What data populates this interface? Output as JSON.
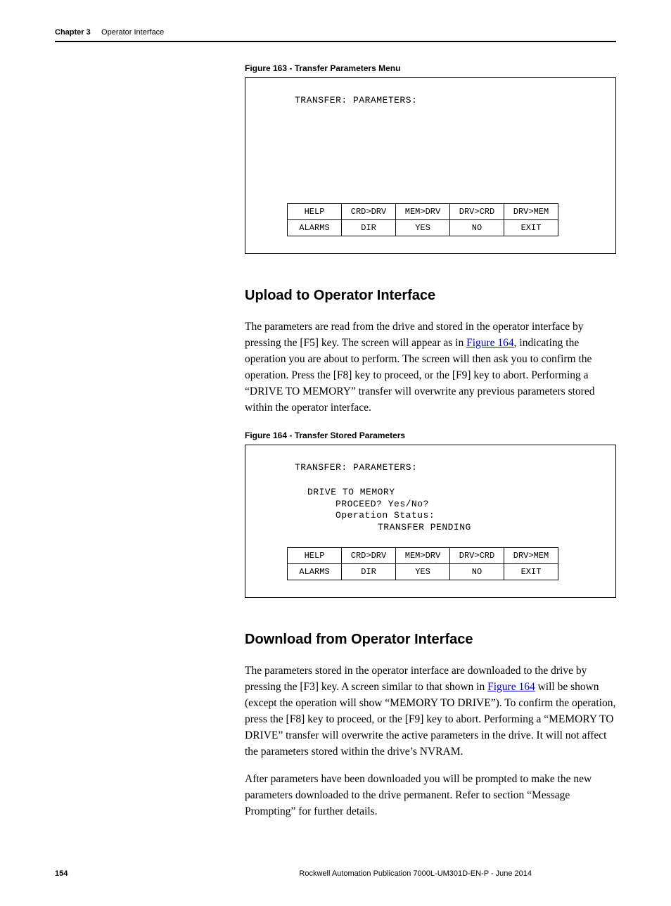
{
  "header": {
    "chapter_label": "Chapter 3",
    "chapter_title": "Operator Interface"
  },
  "figure163": {
    "caption": "Figure 163 - Transfer Parameters Menu",
    "screen_title": "TRANSFER: PARAMETERS:",
    "softkeys_row1": [
      "HELP",
      "CRD>DRV",
      "MEM>DRV",
      "DRV>CRD",
      "DRV>MEM"
    ],
    "softkeys_row2": [
      "ALARMS",
      "DIR",
      "YES",
      "NO",
      "EXIT"
    ]
  },
  "section_upload": {
    "heading": "Upload to Operator Interface",
    "para_pre": "The parameters are read from the drive and stored in the operator interface by pressing the [F5] key. The screen will appear as in ",
    "para_link": "Figure 164",
    "para_post": ", indicating the operation you are about to perform. The screen will then ask you to confirm the operation. Press the [F8] key to proceed, or the [F9] key to abort. Performing a “DRIVE TO MEMORY” transfer will overwrite any previous parameters stored within the operator interface."
  },
  "figure164": {
    "caption": "Figure 164 - Transfer Stored Parameters",
    "screen_title": "TRANSFER: PARAMETERS:",
    "line1": "DRIVE TO MEMORY",
    "line2": "PROCEED?  Yes/No?",
    "line3": "Operation Status:",
    "status_value": "TRANSFER PENDING",
    "softkeys_row1": [
      "HELP",
      "CRD>DRV",
      "MEM>DRV",
      "DRV>CRD",
      "DRV>MEM"
    ],
    "softkeys_row2": [
      "ALARMS",
      "DIR",
      "YES",
      "NO",
      "EXIT"
    ]
  },
  "section_download": {
    "heading": "Download from Operator Interface",
    "para1_pre": "The parameters stored in the operator interface are downloaded to the drive by pressing the [F3] key. A screen similar to that shown in ",
    "para1_link": "Figure 164",
    "para1_post": " will be shown (except the operation will show “MEMORY TO DRIVE”). To confirm the operation, press the [F8] key to proceed, or the [F9] key to abort. Performing a “MEMORY TO DRIVE” transfer will overwrite the active parameters in the drive. It will not affect the parameters stored within the drive’s NVRAM.",
    "para2": "After parameters have been downloaded you will be prompted to make the new parameters downloaded to the drive permanent. Refer to section “Message Prompting” for further details."
  },
  "footer": {
    "page_number": "154",
    "publication": "Rockwell Automation Publication 7000L-UM301D-EN-P - June 2014"
  }
}
